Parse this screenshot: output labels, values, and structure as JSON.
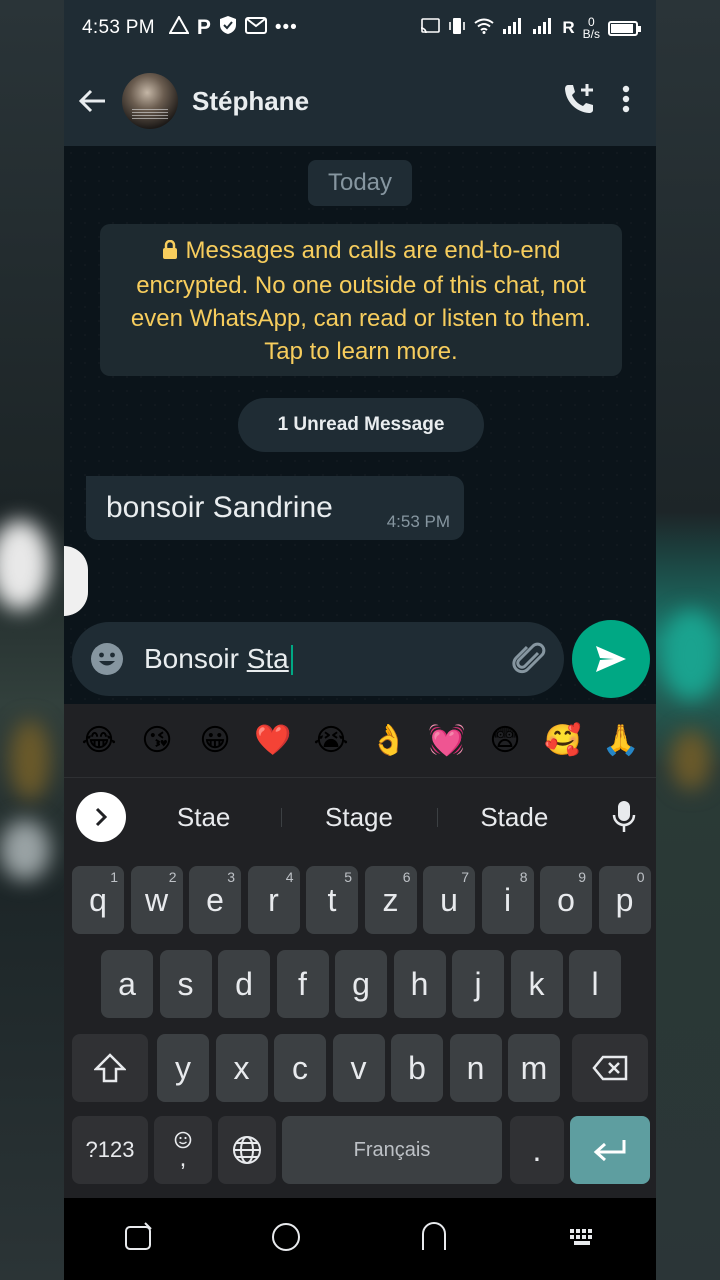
{
  "status_bar": {
    "time": "4:53 PM",
    "left_icons": [
      "warning-icon",
      "p-icon",
      "shield-icon",
      "gmail-icon",
      "more-dots-icon"
    ],
    "network_label": "R",
    "data_speed_value": "0",
    "data_speed_unit": "B/s"
  },
  "header": {
    "contact_name": "Stéphane"
  },
  "chat": {
    "day_label": "Today",
    "encryption_notice": "Messages and calls are end-to-end encrypted. No one outside of this chat, not even WhatsApp, can read or listen to them. Tap to learn more.",
    "unread_label": "1 Unread Message",
    "messages": [
      {
        "text": "bonsoir Sandrine",
        "time": "4:53 PM",
        "direction": "incoming"
      }
    ]
  },
  "compose": {
    "typed_prefix": "Bonsoir ",
    "typed_word": "Sta"
  },
  "keyboard": {
    "emoji_suggestions": [
      "😂",
      "😘",
      "😀",
      "❤️",
      "😭",
      "👌",
      "💓",
      "😨",
      "🥰",
      "🙏"
    ],
    "word_suggestions": [
      "Stae",
      "Stage",
      "Stade"
    ],
    "row1": [
      {
        "k": "q",
        "n": "1"
      },
      {
        "k": "w",
        "n": "2"
      },
      {
        "k": "e",
        "n": "3"
      },
      {
        "k": "r",
        "n": "4"
      },
      {
        "k": "t",
        "n": "5"
      },
      {
        "k": "z",
        "n": "6"
      },
      {
        "k": "u",
        "n": "7"
      },
      {
        "k": "i",
        "n": "8"
      },
      {
        "k": "o",
        "n": "9"
      },
      {
        "k": "p",
        "n": "0"
      }
    ],
    "row2": [
      "a",
      "s",
      "d",
      "f",
      "g",
      "h",
      "j",
      "k",
      "l"
    ],
    "row3": [
      "y",
      "x",
      "c",
      "v",
      "b",
      "n",
      "m"
    ],
    "symbols_label": "?123",
    "comma_label": ",",
    "space_label": "Français",
    "period_label": "."
  },
  "colors": {
    "accent": "#00a884",
    "header_bg": "#1f2c34",
    "chat_bg": "#0b141a",
    "encryption_text": "#f7cd5d",
    "keyboard_bg": "#202124",
    "key_bg": "#3c4043",
    "enter_key": "#5e9ea0"
  }
}
